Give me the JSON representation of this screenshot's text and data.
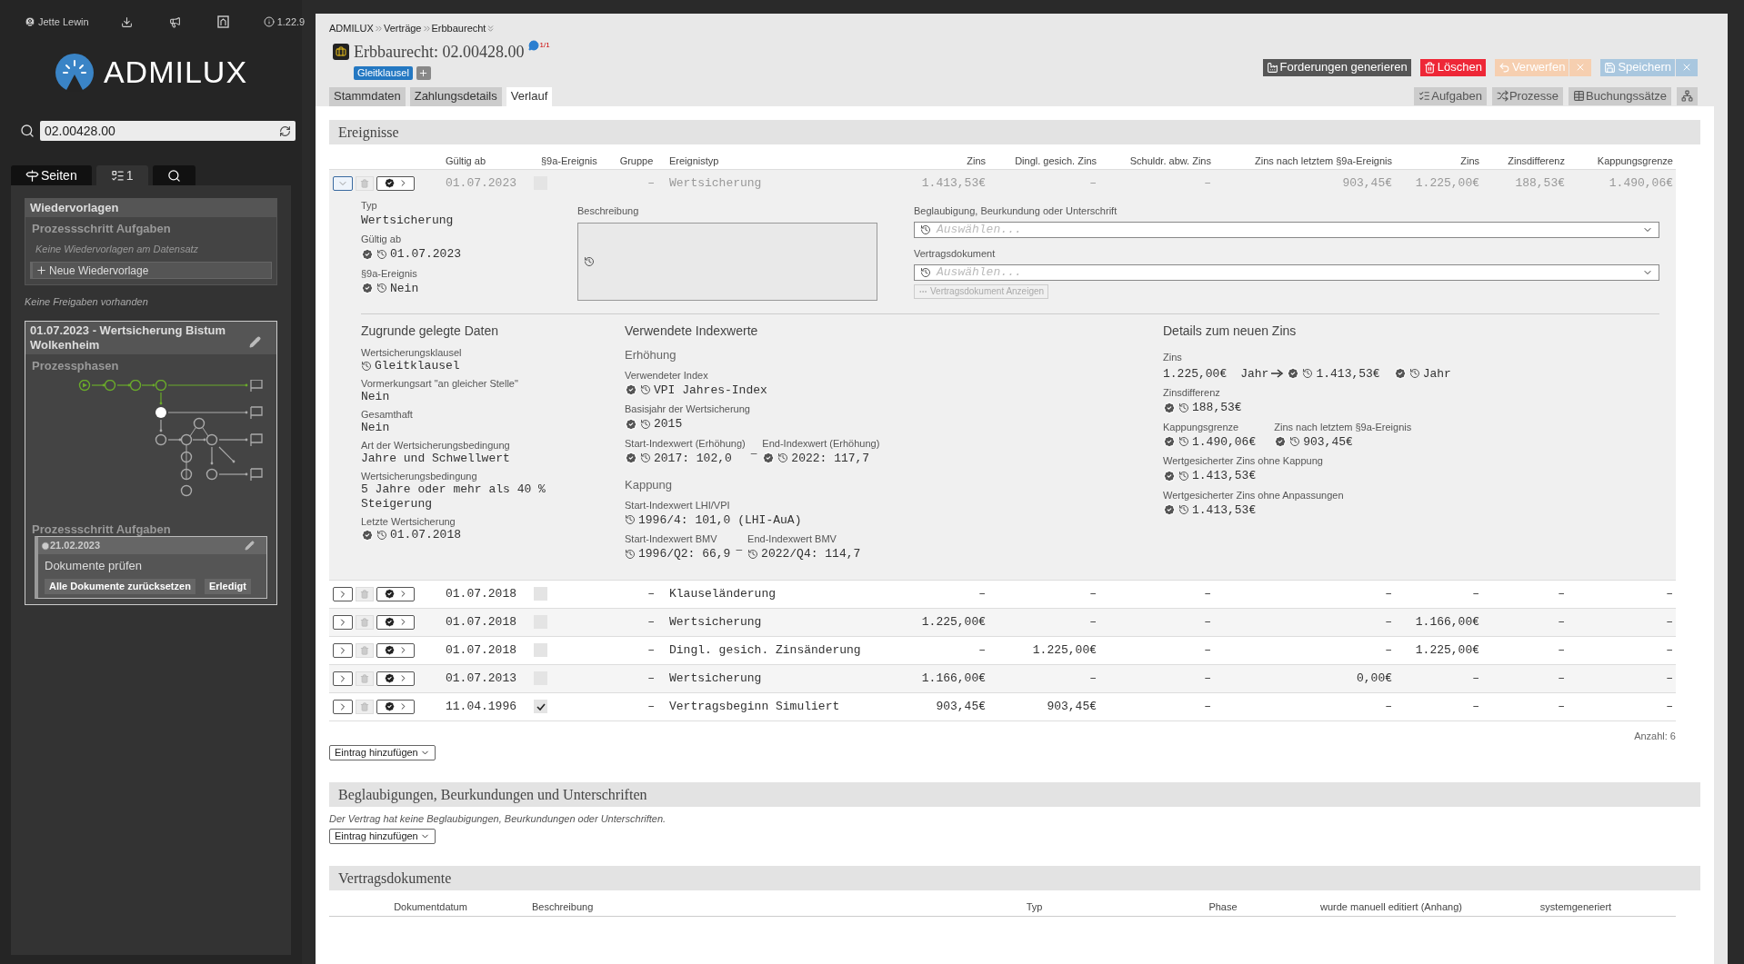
{
  "topbar": {
    "user": "Jette Lewin",
    "version": "1.22.9"
  },
  "logo": {
    "text": "ADMILUX"
  },
  "search": {
    "value": "02.00428.00"
  },
  "side_tabs": [
    {
      "kind": "pages",
      "label": "Seiten",
      "selected": false
    },
    {
      "kind": "tasks",
      "label": "1",
      "selected": true
    },
    {
      "kind": "search",
      "selected": false
    }
  ],
  "wiedervorlagen": {
    "title": "Wiedervorlagen",
    "subtitle": "Prozessschritt Aufgaben",
    "empty": "Keine Wiedervorlagen am Datensatz",
    "button": "Neue Wiedervorlage"
  },
  "freigaben_note": "Keine Freigaben vorhanden",
  "process_card": {
    "title": "01.07.2023 - Wertsicherung Bistum Wolkenheim",
    "phases_label": "Prozessphasen",
    "tasks_label": "Prozessschritt Aufgaben",
    "task": {
      "date": "21.02.2023",
      "title": "Dokumente prüfen",
      "buttons": [
        "Alle Dokumente zurücksetzen",
        "Erledigt"
      ]
    }
  },
  "breadcrumb": [
    "ADMILUX",
    "Verträge",
    "Erbbaurecht"
  ],
  "header": {
    "title": "Erbbaurecht: 02.00428.00",
    "comments": "1/1",
    "tag": "Gleitklausel"
  },
  "actions": [
    {
      "kind": "dark",
      "label": "Forderungen generieren",
      "disabled": false,
      "closable": false
    },
    {
      "kind": "danger",
      "label": "Löschen",
      "disabled": false,
      "closable": false
    },
    {
      "kind": "warning",
      "label": "Verwerfen",
      "disabled": true,
      "closable": true
    },
    {
      "kind": "primary",
      "label": "Speichern",
      "disabled": true,
      "closable": true
    }
  ],
  "tabs": [
    {
      "label": "Stammdaten",
      "selected": false
    },
    {
      "label": "Zahlungsdetails",
      "selected": false
    },
    {
      "label": "Verlauf",
      "selected": true
    }
  ],
  "right_tabs": [
    {
      "kind": "tasks",
      "label": "Aufgaben"
    },
    {
      "kind": "processes",
      "label": "Prozesse"
    },
    {
      "kind": "bookings",
      "label": "Buchungssätze"
    },
    {
      "kind": "tree"
    }
  ],
  "events": {
    "title": "Ereignisse",
    "columns": [
      "Gültig ab",
      "§9a-Ereignis",
      "Gruppe",
      "Ereignistyp",
      "Zins",
      "Dingl. gesich. Zins",
      "Schuldr. abw. Zins",
      "Zins nach letztem §9a-Ereignis",
      "Zins",
      "Zinsdifferenz",
      "Kappungsgrenze"
    ],
    "rows": [
      {
        "expanded": true,
        "cells": [
          {
            "kind": "text",
            "text": "01.07.2023"
          },
          {
            "kind": "checkbox",
            "checked": false
          },
          {
            "kind": "text",
            "text": "–"
          },
          {
            "kind": "text",
            "text": "Wertsicherung"
          },
          {
            "kind": "text",
            "text": "1.413,53€"
          },
          {
            "kind": "text",
            "text": "–"
          },
          {
            "kind": "text",
            "text": "–"
          },
          {
            "kind": "text",
            "text": "903,45€"
          },
          {
            "kind": "text",
            "text": "1.225,00€"
          },
          {
            "kind": "text",
            "text": "188,53€"
          },
          {
            "kind": "text",
            "text": "1.490,06€"
          }
        ]
      },
      {
        "expanded": false,
        "cells": [
          {
            "kind": "text",
            "text": "01.07.2018"
          },
          {
            "kind": "checkbox",
            "checked": false
          },
          {
            "kind": "text",
            "text": "–"
          },
          {
            "kind": "text",
            "text": "Klauseländerung"
          },
          {
            "kind": "text",
            "text": "–"
          },
          {
            "kind": "text",
            "text": "–"
          },
          {
            "kind": "text",
            "text": "–"
          },
          {
            "kind": "text",
            "text": "–"
          },
          {
            "kind": "text",
            "text": "–"
          },
          {
            "kind": "text",
            "text": "–"
          },
          {
            "kind": "text",
            "text": "–"
          }
        ]
      },
      {
        "expanded": false,
        "cells": [
          {
            "kind": "text",
            "text": "01.07.2018"
          },
          {
            "kind": "checkbox",
            "checked": false
          },
          {
            "kind": "text",
            "text": "–"
          },
          {
            "kind": "text",
            "text": "Wertsicherung"
          },
          {
            "kind": "text",
            "text": "1.225,00€"
          },
          {
            "kind": "text",
            "text": "–"
          },
          {
            "kind": "text",
            "text": "–"
          },
          {
            "kind": "text",
            "text": "–"
          },
          {
            "kind": "text",
            "text": "1.166,00€"
          },
          {
            "kind": "text",
            "text": "–"
          },
          {
            "kind": "text",
            "text": "–"
          }
        ]
      },
      {
        "expanded": false,
        "cells": [
          {
            "kind": "text",
            "text": "01.07.2018"
          },
          {
            "kind": "checkbox",
            "checked": false
          },
          {
            "kind": "text",
            "text": "–"
          },
          {
            "kind": "text",
            "text": "Dingl. gesich. Zinsänderung"
          },
          {
            "kind": "text",
            "text": "–"
          },
          {
            "kind": "text",
            "text": "1.225,00€"
          },
          {
            "kind": "text",
            "text": "–"
          },
          {
            "kind": "text",
            "text": "–"
          },
          {
            "kind": "text",
            "text": "1.225,00€"
          },
          {
            "kind": "text",
            "text": "–"
          },
          {
            "kind": "text",
            "text": "–"
          }
        ]
      },
      {
        "expanded": false,
        "cells": [
          {
            "kind": "text",
            "text": "01.07.2013"
          },
          {
            "kind": "checkbox",
            "checked": false
          },
          {
            "kind": "text",
            "text": "–"
          },
          {
            "kind": "text",
            "text": "Wertsicherung"
          },
          {
            "kind": "text",
            "text": "1.166,00€"
          },
          {
            "kind": "text",
            "text": "–"
          },
          {
            "kind": "text",
            "text": "–"
          },
          {
            "kind": "text",
            "text": "0,00€"
          },
          {
            "kind": "text",
            "text": "–"
          },
          {
            "kind": "text",
            "text": "–"
          },
          {
            "kind": "text",
            "text": "–"
          }
        ]
      },
      {
        "expanded": false,
        "cells": [
          {
            "kind": "text",
            "text": "11.04.1996"
          },
          {
            "kind": "checkbox",
            "checked": true
          },
          {
            "kind": "text",
            "text": "–"
          },
          {
            "kind": "text",
            "text": "Vertragsbeginn Simuliert"
          },
          {
            "kind": "text",
            "text": "903,45€"
          },
          {
            "kind": "text",
            "text": "903,45€"
          },
          {
            "kind": "text",
            "text": "–"
          },
          {
            "kind": "text",
            "text": "–"
          },
          {
            "kind": "text",
            "text": "–"
          },
          {
            "kind": "text",
            "text": "–"
          },
          {
            "kind": "text",
            "text": "–"
          }
        ]
      }
    ],
    "detail": {
      "fields": [
        {
          "label": "Typ",
          "value": "Wertsicherung",
          "kind": "plain"
        },
        {
          "label": "Gültig ab",
          "value": "01.07.2023",
          "kind": "verified"
        },
        {
          "label": "§9a-Ereignis",
          "value": "Nein",
          "kind": "verified"
        }
      ],
      "description_label": "Beschreibung",
      "selects": [
        {
          "label": "Beglaubigung, Beurkundung oder Unterschrift",
          "placeholder": "Auswählen..."
        },
        {
          "label": "Vertragsdokument",
          "placeholder": "Auswählen..."
        }
      ],
      "show_button": "Vertragsdokument Anzeigen",
      "base": {
        "title": "Zugrunde gelegte Daten",
        "fields": [
          {
            "label": "Wertsicherungsklausel",
            "value": "Gleitklausel",
            "kind": "history"
          },
          {
            "label": "Vormerkungsart \"an gleicher Stelle\"",
            "value": "Nein",
            "kind": "plain"
          },
          {
            "label": "Gesamthaft",
            "value": "Nein",
            "kind": "plain"
          },
          {
            "label": "Art der Wertsicherungsbedingung",
            "value": "Jahre und Schwellwert",
            "kind": "plain"
          },
          {
            "label": "Wertsicherungsbedingung",
            "value": "5 Jahre oder mehr als 40 % Steigerung",
            "kind": "plain"
          },
          {
            "label": "Letzte Wertsicherung",
            "value": "01.07.2018",
            "kind": "verified"
          }
        ]
      },
      "index": {
        "title": "Verwendete Indexwerte",
        "groups": [
          {
            "title": "Erhöhung",
            "rows": [
              {
                "fields": [
                  {
                    "label": "Verwendeter Index",
                    "value": "VPI Jahres-Index",
                    "kind": "verified"
                  }
                ]
              },
              {
                "fields": [
                  {
                    "label": "Basisjahr der Wertsicherung",
                    "value": "2015",
                    "kind": "verified"
                  }
                ]
              },
              {
                "separator": "–",
                "fields": [
                  {
                    "label": "Start-Indexwert (Erhöhung)",
                    "value": "2017: 102,0",
                    "kind": "verified"
                  },
                  {
                    "label": "End-Indexwert (Erhöhung)",
                    "value": "2022: 117,7",
                    "kind": "verified"
                  }
                ]
              }
            ]
          },
          {
            "title": "Kappung",
            "rows": [
              {
                "fields": [
                  {
                    "label": "Start-Indexwert LHI/VPI",
                    "value": "1996/4: 101,0 (LHI-AuA)",
                    "kind": "history"
                  }
                ]
              },
              {
                "separator": "–",
                "fields": [
                  {
                    "label": "Start-Indexwert BMV",
                    "value": "1996/Q2: 66,9",
                    "kind": "history"
                  },
                  {
                    "label": "End-Indexwert BMV",
                    "value": "2022/Q4: 114,7",
                    "kind": "history"
                  }
                ]
              }
            ]
          }
        ]
      },
      "new_rate": {
        "title": "Details zum neuen Zins",
        "change": {
          "label": "Zins",
          "from_amount": "1.225,00€",
          "from_unit": "Jahr",
          "to_amount": "1.413,53€",
          "to_unit": "Jahr"
        },
        "rows": [
          {
            "fields": [
              {
                "label": "Zinsdifferenz",
                "value": "188,53€",
                "kind": "verified"
              }
            ]
          },
          {
            "fields": [
              {
                "label": "Kappungsgrenze",
                "value": "1.490,06€",
                "kind": "verified"
              },
              {
                "label": "Zins nach letztem §9a-Ereignis",
                "value": "903,45€",
                "kind": "verified"
              }
            ]
          },
          {
            "fields": [
              {
                "label": "Wertgesicherter Zins ohne Kappung",
                "value": "1.413,53€",
                "kind": "verified"
              }
            ]
          },
          {
            "fields": [
              {
                "label": "Wertgesicherter Zins ohne Anpassungen",
                "value": "1.413,53€",
                "kind": "verified"
              }
            ]
          }
        ]
      }
    },
    "count": "Anzahl: 6",
    "add_button": "Eintrag hinzufügen"
  },
  "certifications": {
    "title": "Beglaubigungen, Beurkundungen und Unterschriften",
    "note": "Der Vertrag hat keine Beglaubigungen, Beurkundungen oder Unterschriften.",
    "add_button": "Eintrag hinzufügen"
  },
  "documents": {
    "title": "Vertragsdokumente",
    "columns": [
      "Dokumentdatum",
      "Beschreibung",
      "Typ",
      "Phase",
      "wurde manuell editiert (Anhang)",
      "systemgeneriert"
    ]
  }
}
